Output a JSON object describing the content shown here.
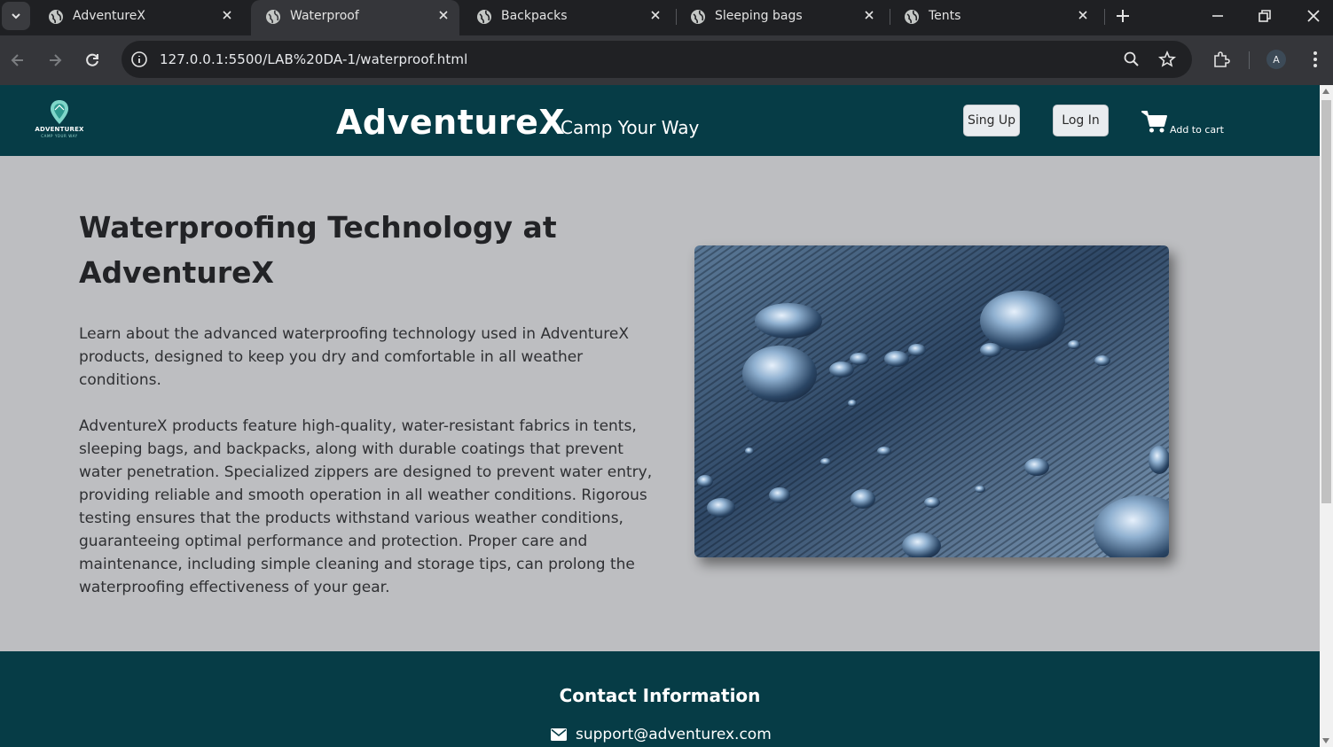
{
  "browser": {
    "tabs": [
      {
        "title": "AdventureX",
        "active": false
      },
      {
        "title": "Waterproof",
        "active": true
      },
      {
        "title": "Backpacks",
        "active": false
      },
      {
        "title": "Sleeping bags",
        "active": false
      },
      {
        "title": "Tents",
        "active": false
      }
    ],
    "url": "127.0.0.1:5500/LAB%20DA-1/waterproof.html",
    "profile_initial": "A"
  },
  "header": {
    "logo_text": "ADVENTUREX",
    "logo_subtext": "CAMP YOUR WAY",
    "brand": "AdventureX",
    "tagline": "Camp Your Way",
    "signup_label": "Sing Up",
    "login_label": "Log In",
    "cart_label": "Add to cart"
  },
  "main": {
    "heading": "Waterproofing Technology at AdventureX",
    "paragraph_1": "Learn about the advanced waterproofing technology used in AdventureX products, designed to keep you dry and comfortable in all weather conditions.",
    "paragraph_2": "AdventureX products feature high-quality, water-resistant fabrics in tents, sleeping bags, and backpacks, along with durable coatings that prevent water penetration. Specialized zippers are designed to prevent water entry, providing reliable and smooth operation in all weather conditions. Rigorous testing ensures that the products withstand various weather conditions, guaranteeing optimal performance and protection. Proper care and maintenance, including simple cleaning and storage tips, can prolong the waterproofing effectiveness of your gear.",
    "image_subject": "water droplets on woven fabric"
  },
  "footer": {
    "contact_title": "Contact Information",
    "email": "support@adventurex.com"
  },
  "colors": {
    "header_bg": "#063c46",
    "page_bg": "#bdbec1",
    "chrome_dark": "#1f2023",
    "chrome_toolbar": "#35363a"
  },
  "icons": [
    "tab-list-icon",
    "globe-icon",
    "close-icon",
    "new-tab-icon",
    "minimize-icon",
    "restore-icon",
    "window-close-icon",
    "back-icon",
    "forward-icon",
    "reload-icon",
    "site-info-icon",
    "zoom-icon",
    "bookmark-star-icon",
    "extensions-icon",
    "kebab-menu-icon",
    "map-pin-logo-icon",
    "cart-icon",
    "envelope-icon"
  ]
}
